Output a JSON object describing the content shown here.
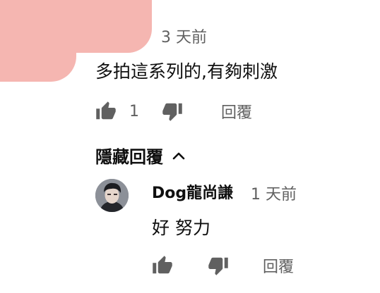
{
  "comment": {
    "timestamp": "3 天前",
    "text": "多拍這系列的,有夠刺激",
    "like_count": "1",
    "reply_label": "回覆"
  },
  "replies_toggle": {
    "label": "隱藏回覆"
  },
  "reply": {
    "author": "Dog龍尚謙",
    "timestamp": "1 天前",
    "text": "好 努力",
    "reply_label": "回覆"
  },
  "colors": {
    "secondary_text": "#606060",
    "primary_text": "#0f0f0f",
    "avatar_pink": "#f5b6b1"
  },
  "icons": {
    "like": "thumb-up-icon",
    "dislike": "thumb-down-icon",
    "collapse": "chevron-up-icon"
  }
}
